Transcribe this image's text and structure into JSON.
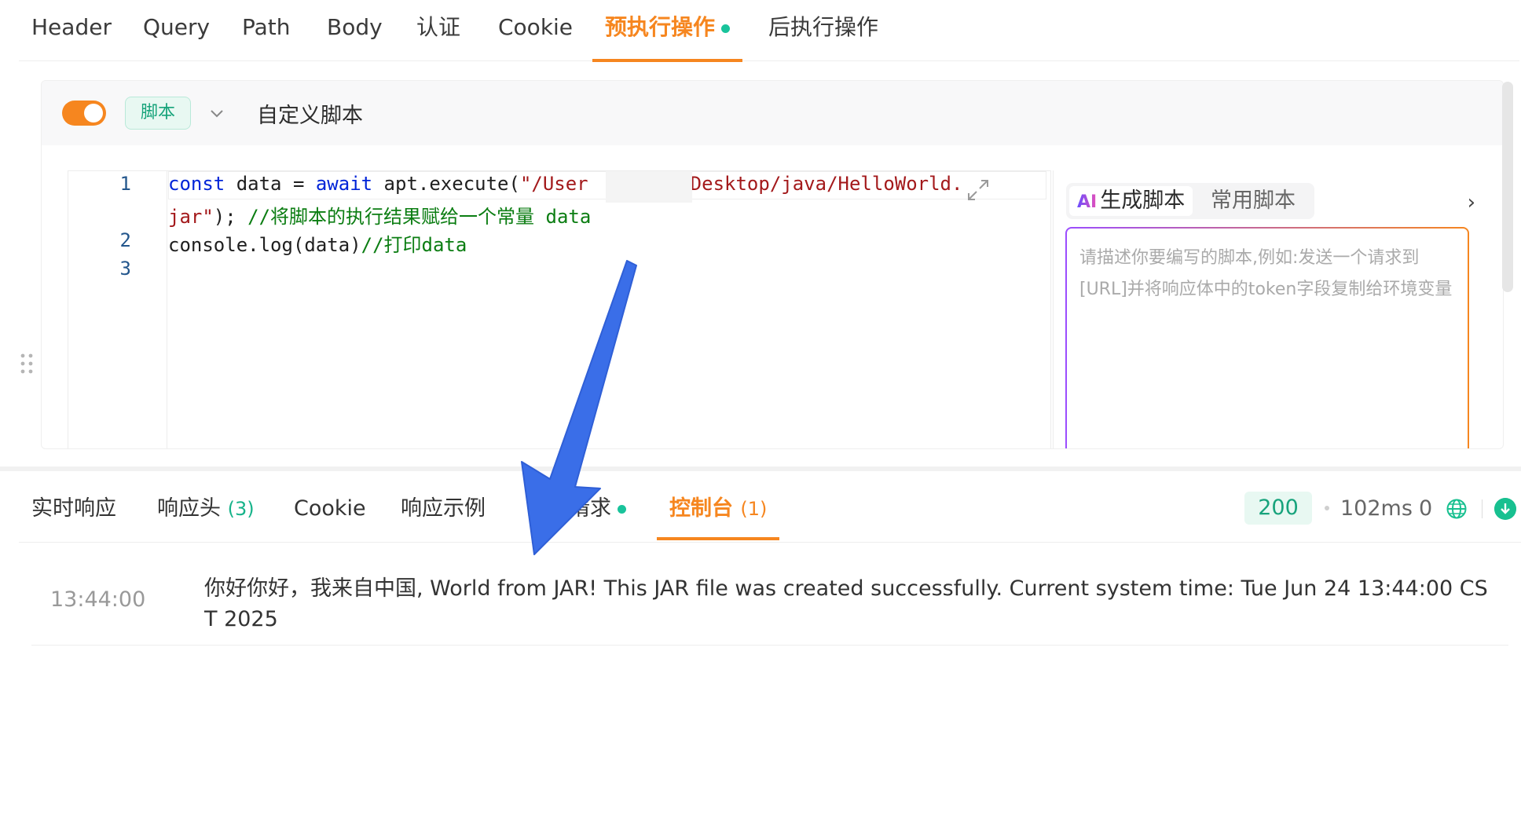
{
  "top_tabs": [
    {
      "label": "Header"
    },
    {
      "label": "Query"
    },
    {
      "label": "Path"
    },
    {
      "label": "Body"
    },
    {
      "label": "认证"
    },
    {
      "label": "Cookie"
    },
    {
      "label": "预执行操作",
      "active": true,
      "has_dot": true
    },
    {
      "label": "后执行操作"
    }
  ],
  "script_panel": {
    "enabled": true,
    "tag": "脚本",
    "title": "自定义脚本",
    "line_numbers": [
      "1",
      "2",
      "3"
    ],
    "code": {
      "l1_kw1": "const",
      "l1_a": " data = ",
      "l1_kw2": "await",
      "l1_b": " apt.execute(",
      "l1_str": "\"/User         Desktop/java/HelloWorld.",
      "l1w_str": "jar\"",
      "l1w_b": "); ",
      "l1w_cm": "//将脚本的执行结果赋给一个常量 data",
      "l2_a": "console.log(data)",
      "l2_cm": "//打印data"
    }
  },
  "ai_panel": {
    "tab_generate": "生成脚本",
    "tab_generate_mark": "AI",
    "tab_common": "常用脚本",
    "more": "›",
    "placeholder": "请描述你要编写的脚本,例如:发送一个请求到[URL]并将响应体中的token字段复制给环境变量"
  },
  "response": {
    "tabs": [
      {
        "label": "实时响应"
      },
      {
        "label": "响应头",
        "count": "(3)"
      },
      {
        "label": "Cookie"
      },
      {
        "label": "响应示例"
      },
      {
        "label": "实际请求",
        "has_dot": true
      },
      {
        "label": "控制台",
        "count": "(1)",
        "active": true
      }
    ],
    "status_code": "200",
    "duration": "102ms",
    "size": "0",
    "console": [
      {
        "time": "13:44:00",
        "message": "你好你好，我来自中国, World from JAR! This JAR file was created successfully. Current system time: Tue Jun 24 13:44:00 CST 2025"
      }
    ]
  },
  "colors": {
    "accent": "#f6861f",
    "success": "#17a37c",
    "annotation_arrow": "#3a6ee8"
  }
}
